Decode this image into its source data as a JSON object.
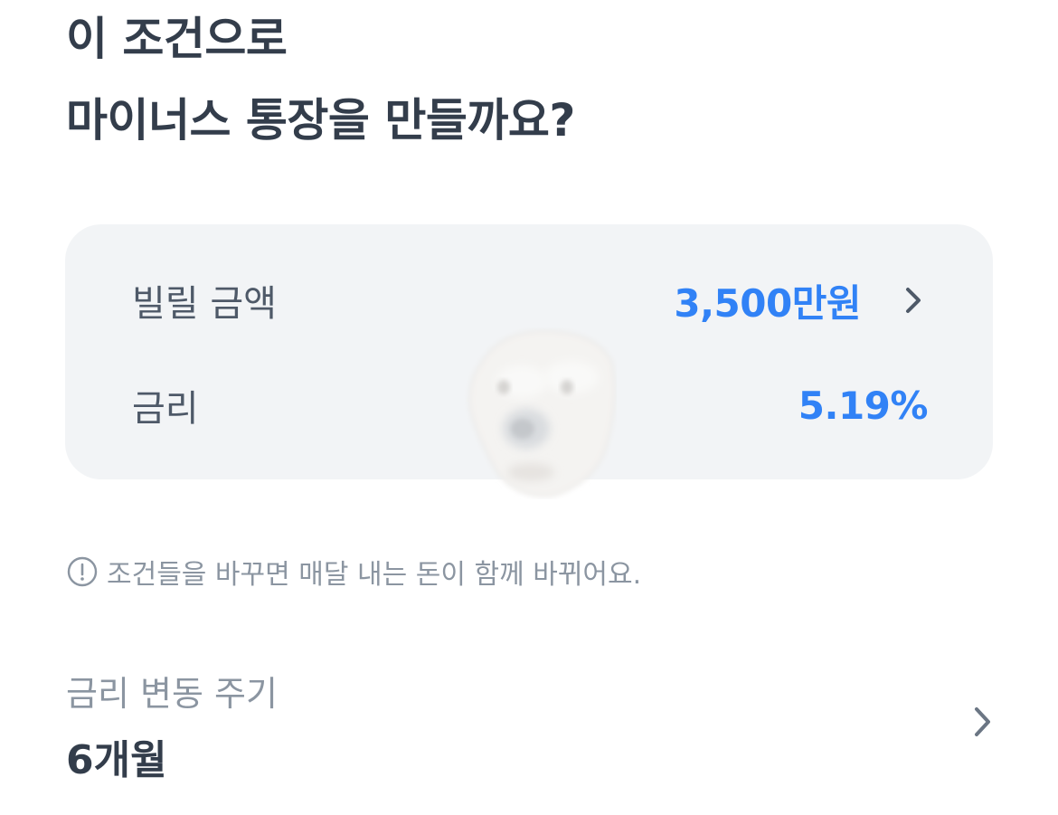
{
  "header": {
    "title_line1": "이 조건으로",
    "title_line2": "마이너스 통장을 만들까요?"
  },
  "summary_card": {
    "amount_label": "빌릴 금액",
    "amount_value": "3,500만원",
    "rate_label": "금리",
    "rate_value": "5.19%"
  },
  "notice": {
    "icon": "info-circle-icon",
    "text": "조건들을 바꾸면 매달 내는 돈이 함께 바뀌어요."
  },
  "rate_change_period": {
    "label": "금리 변동 주기",
    "value": "6개월"
  },
  "overlay": {
    "icon": "dog-face-sticker"
  },
  "colors": {
    "accent": "#3182f6",
    "card_bg": "#f2f4f6",
    "text_primary": "#333d4b",
    "text_secondary": "#4e5968",
    "text_muted": "#8b95a1"
  }
}
